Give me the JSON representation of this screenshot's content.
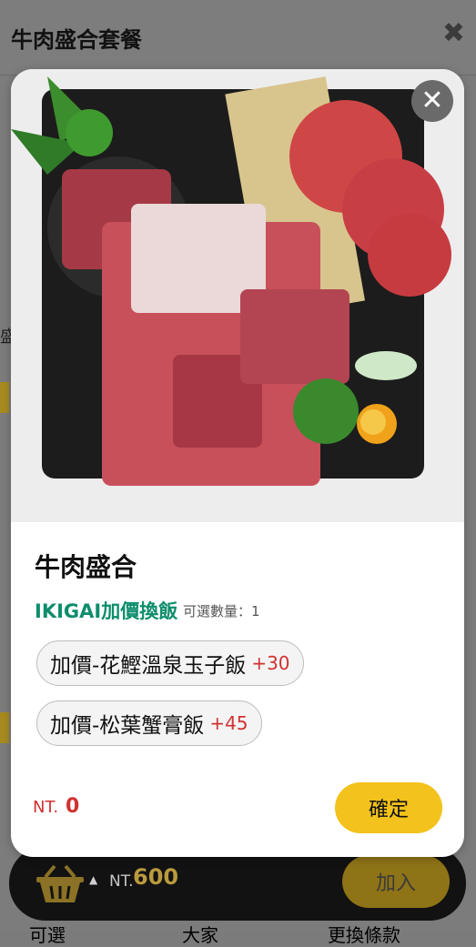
{
  "background": {
    "header_title": "牛肉盛合套餐",
    "close_glyph": "✖",
    "side_text": "盛",
    "bottom_texts": [
      "可選",
      "大家",
      "更換條款"
    ]
  },
  "bottom_bar": {
    "price_label": "NT.",
    "price_value": "600",
    "add_label": "加入"
  },
  "modal": {
    "image_icon": "beef-platter-photo",
    "close_glyph": "✕",
    "title": "牛肉盛合",
    "option_group": {
      "title": "IKIGAI加價換飯",
      "quantity_text": "可選數量：1",
      "options": [
        {
          "name": "加價-花鰹溫泉玉子飯",
          "price": "+30"
        },
        {
          "name": "加價-松葉蟹膏飯",
          "price": "+45"
        }
      ]
    },
    "total_label": "NT.",
    "total_value": "0",
    "confirm_label": "確定"
  },
  "colors": {
    "accent_yellow": "#f3c21c",
    "price_red": "#d23131",
    "option_green": "#0d8d6c"
  }
}
